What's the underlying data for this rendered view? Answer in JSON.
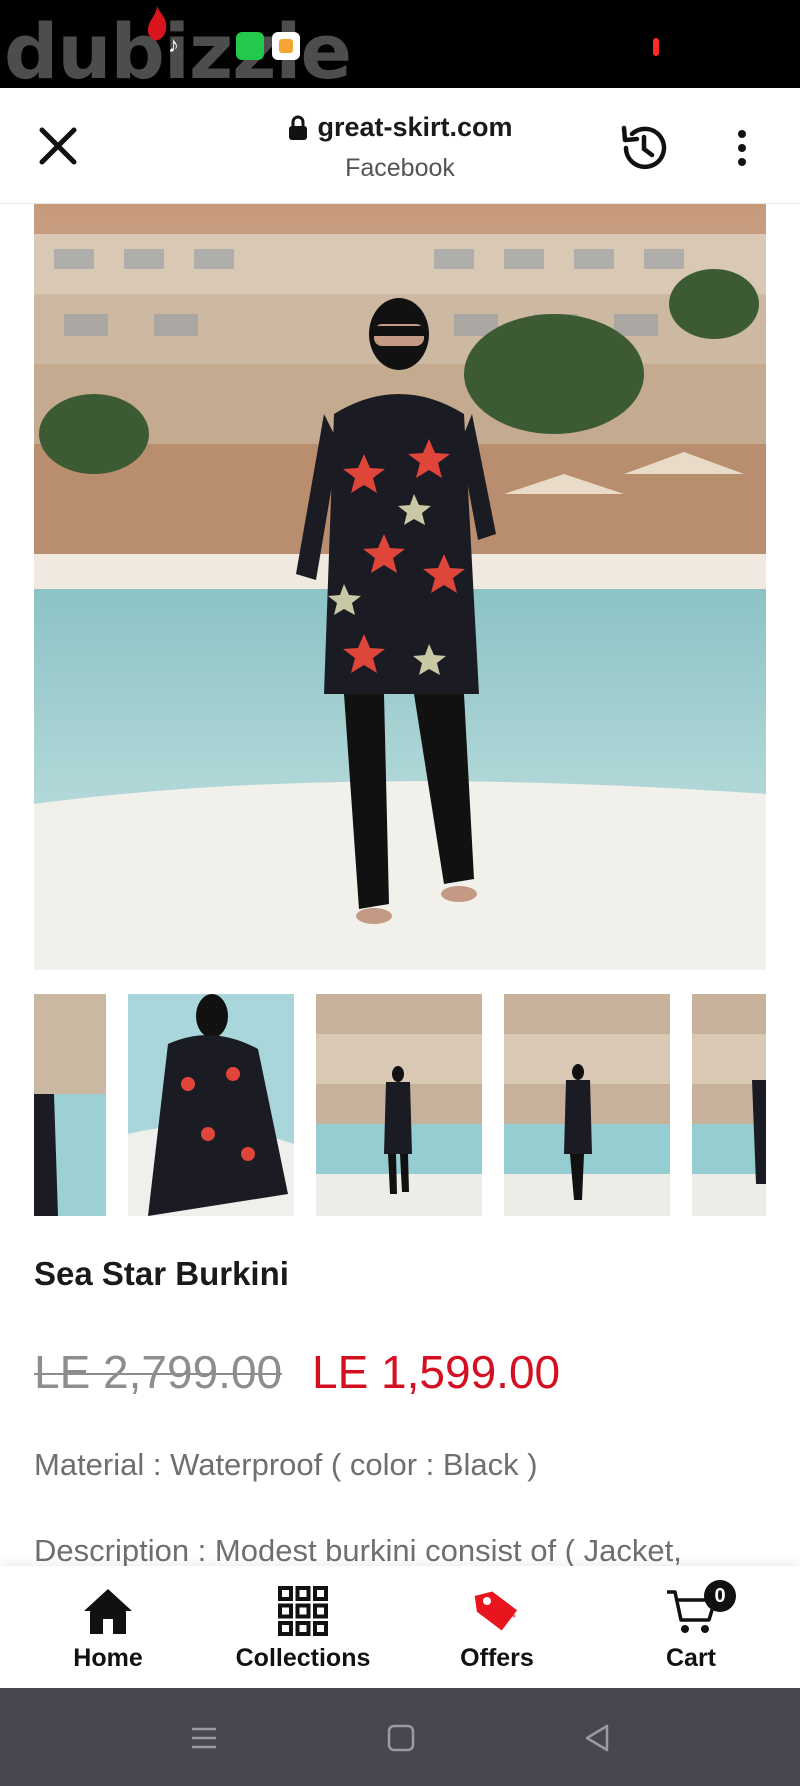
{
  "status_bar": {
    "watermark": "dubizzle",
    "icons": [
      "flame-icon",
      "tiktok-icon",
      "app-green-icon",
      "app-orange-icon",
      "record-dot-icon"
    ]
  },
  "browser": {
    "url": "great-skirt.com",
    "referrer": "Facebook",
    "icons": [
      "close-icon",
      "lock-icon",
      "history-icon",
      "more-vert-icon"
    ]
  },
  "product": {
    "title": "Sea Star Burkini",
    "old_price": "LE 2,799.00",
    "price": "LE 1,599.00",
    "material": "Material : Waterproof ( color : Black )",
    "description": "Description : Modest burkini consist of ( Jacket,",
    "thumbnail_count": 5
  },
  "bottom_nav": {
    "items": [
      {
        "label": "Home",
        "icon": "home-icon"
      },
      {
        "label": "Collections",
        "icon": "grid-icon"
      },
      {
        "label": "Offers",
        "icon": "tag-icon"
      },
      {
        "label": "Cart",
        "icon": "cart-icon"
      }
    ],
    "cart_count": "0"
  },
  "colors": {
    "price_red": "#d40f1f",
    "offer_red": "#e8141e",
    "system_nav": "#47474f"
  }
}
